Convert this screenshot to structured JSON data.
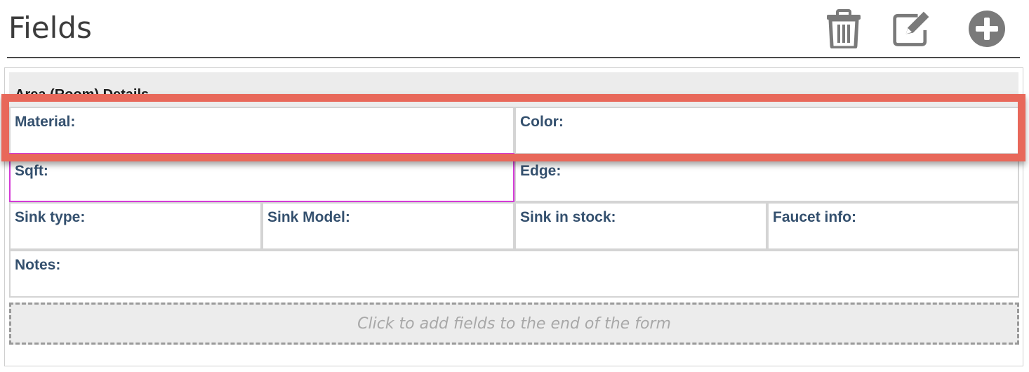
{
  "header": {
    "title": "Fields",
    "icons": [
      "trash-icon",
      "edit-icon",
      "add-circle-icon"
    ]
  },
  "form": {
    "section_title": "Area (Room) Details",
    "fields": {
      "material": "Material:",
      "color": "Color:",
      "sqft": "Sqft:",
      "edge": "Edge:",
      "sink_type": "Sink type:",
      "sink_model": "Sink Model:",
      "sink_in_stock": "Sink in stock:",
      "faucet_info": "Faucet info:",
      "notes": "Notes:"
    },
    "add_fields_text": "Click to add fields to the end of the form"
  },
  "colors": {
    "highlight": "#e8685a",
    "selected_border": "#d33ad6",
    "label": "#34506e",
    "icon": "#7a7a7a"
  }
}
